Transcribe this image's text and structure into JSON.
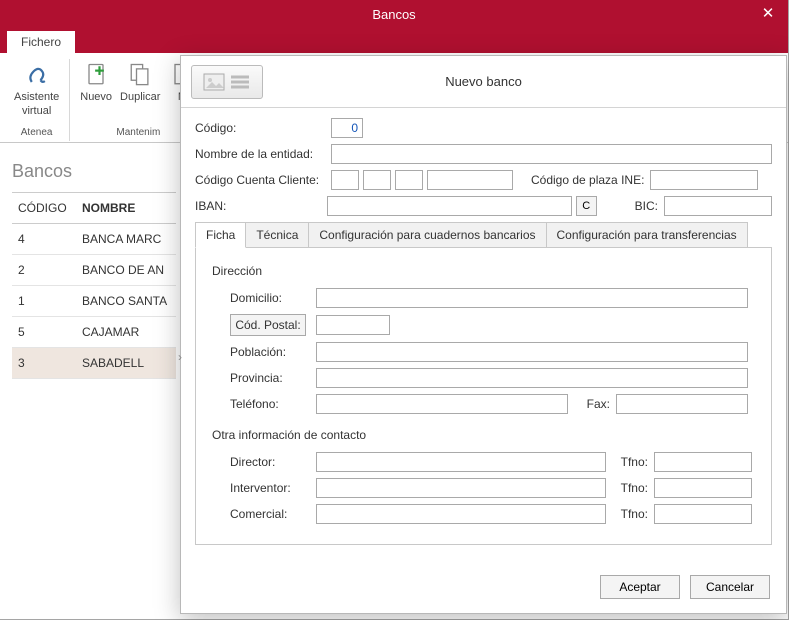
{
  "window": {
    "title": "Bancos",
    "close": "✕"
  },
  "fichero_tab": "Fichero",
  "ribbon": {
    "asistente": {
      "l1": "Asistente",
      "l2": "virtual"
    },
    "atenea_group": "Atenea",
    "nuevo": "Nuevo",
    "duplicar": "Duplicar",
    "mod_partial": "M",
    "manten_group": "Mantenim"
  },
  "bgpage": {
    "heading": "Bancos",
    "col_codigo": "CÓDIGO",
    "col_nombre": "NOMBRE",
    "rows": [
      {
        "codigo": "4",
        "nombre": "BANCA MARC"
      },
      {
        "codigo": "2",
        "nombre": "BANCO DE AN"
      },
      {
        "codigo": "1",
        "nombre": "BANCO SANTA"
      },
      {
        "codigo": "5",
        "nombre": "CAJAMAR"
      },
      {
        "codigo": "3",
        "nombre": "SABADELL"
      }
    ],
    "selected": 4
  },
  "modal": {
    "title": "Nuevo banco",
    "labels": {
      "codigo": "Código:",
      "nombre_entidad": "Nombre de la entidad:",
      "ccc": "Código Cuenta Cliente:",
      "plaza_ine": "Código de plaza INE:",
      "iban": "IBAN:",
      "bic": "BIC:",
      "c_btn": "C"
    },
    "codigo_value": "0",
    "tabs": {
      "ficha": "Ficha",
      "tecnica": "Técnica",
      "cuadernos": "Configuración para cuadernos bancarios",
      "transfer": "Configuración para transferencias"
    },
    "ficha": {
      "direccion": "Dirección",
      "domicilio": "Domicilio:",
      "codpostal": "Cód. Postal:",
      "poblacion": "Población:",
      "provincia": "Provincia:",
      "telefono": "Teléfono:",
      "fax": "Fax:",
      "otra": "Otra información de contacto",
      "director": "Director:",
      "interventor": "Interventor:",
      "comercial": "Comercial:",
      "tfno": "Tfno:"
    },
    "buttons": {
      "aceptar": "Aceptar",
      "cancelar": "Cancelar"
    }
  }
}
